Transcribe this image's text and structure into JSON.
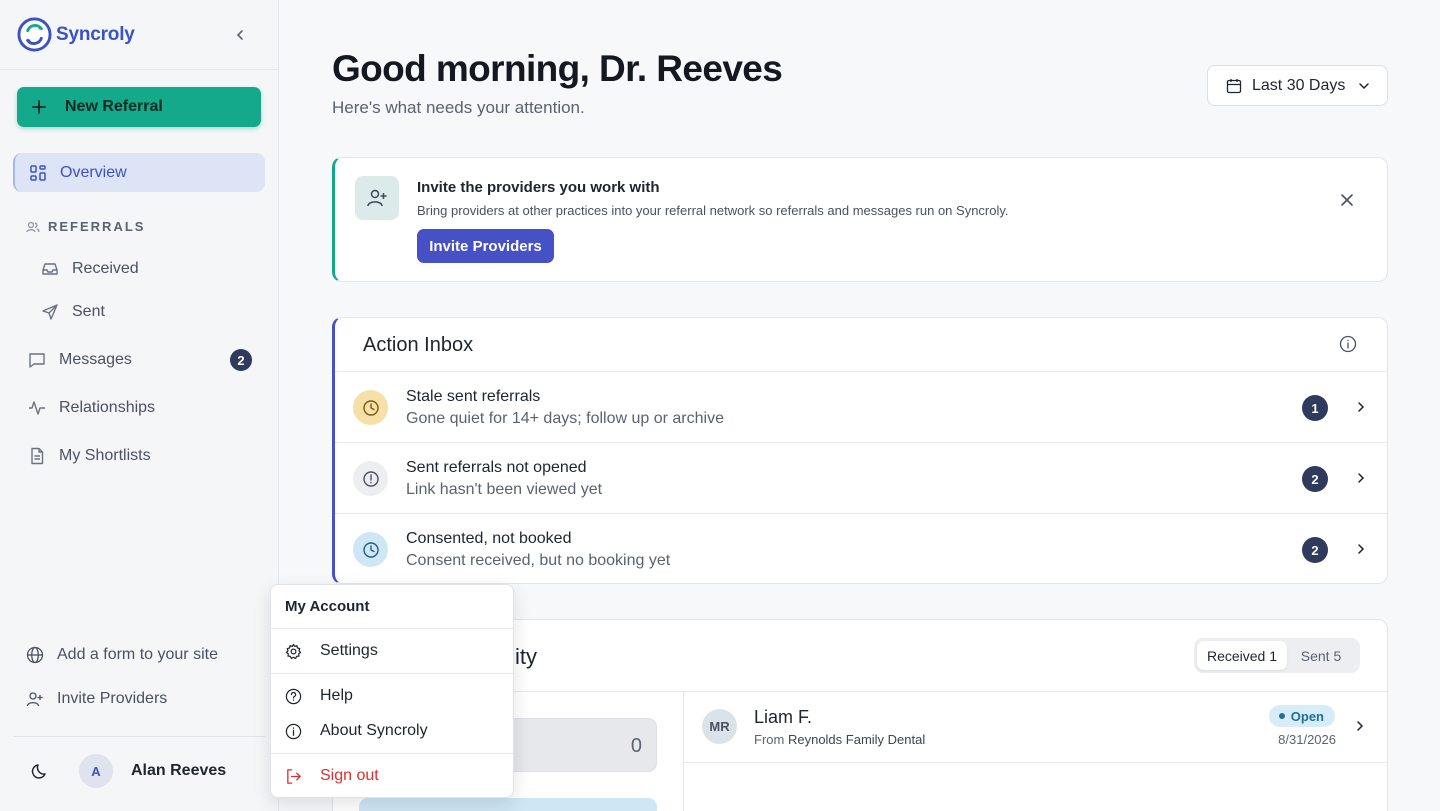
{
  "brand": {
    "name": "Syncroly"
  },
  "sidebar": {
    "new_referral": "New Referral",
    "overview": "Overview",
    "section_referrals": "REFERRALS",
    "received": "Received",
    "sent": "Sent",
    "messages": "Messages",
    "messages_badge": "2",
    "relationships": "Relationships",
    "shortlists": "My Shortlists",
    "add_form": "Add a form to your site",
    "invite_providers": "Invite Providers",
    "user_initial": "A",
    "user_name": "Alan Reeves"
  },
  "header": {
    "greeting": "Good morning, Dr. Reeves",
    "subtitle": "Here's what needs your attention.",
    "date_range": "Last 30 Days"
  },
  "invite_card": {
    "title": "Invite the providers you work with",
    "description": "Bring providers at other practices into your referral network so referrals and messages run on Syncroly.",
    "button": "Invite Providers"
  },
  "action_inbox": {
    "title": "Action Inbox",
    "rows": [
      {
        "title": "Stale sent referrals",
        "subtitle": "Gone quiet for 14+ days; follow up or archive",
        "count": "1"
      },
      {
        "title": "Sent referrals not opened",
        "subtitle": "Link hasn't been viewed yet",
        "count": "2"
      },
      {
        "title": "Consented, not booked",
        "subtitle": "Consent received, but no booking yet",
        "count": "2"
      }
    ]
  },
  "activity": {
    "title_visible": "ity",
    "tab_received": "Received 1",
    "tab_sent": "Sent 5",
    "count_value": "0",
    "referral": {
      "initials": "MR",
      "name": "Liam F.",
      "from_label": "From",
      "from_practice": "Reynolds Family Dental",
      "status": "Open",
      "date": "8/31/2026"
    }
  },
  "account_menu": {
    "header": "My Account",
    "settings": "Settings",
    "help": "Help",
    "about": "About Syncroly",
    "sign_out": "Sign out"
  },
  "colors": {
    "brand": "#3b52c4",
    "accent_green": "#13a98a",
    "accent_indigo": "#4551c4",
    "badge": "#2f3a5c",
    "danger": "#dc2f2f"
  }
}
